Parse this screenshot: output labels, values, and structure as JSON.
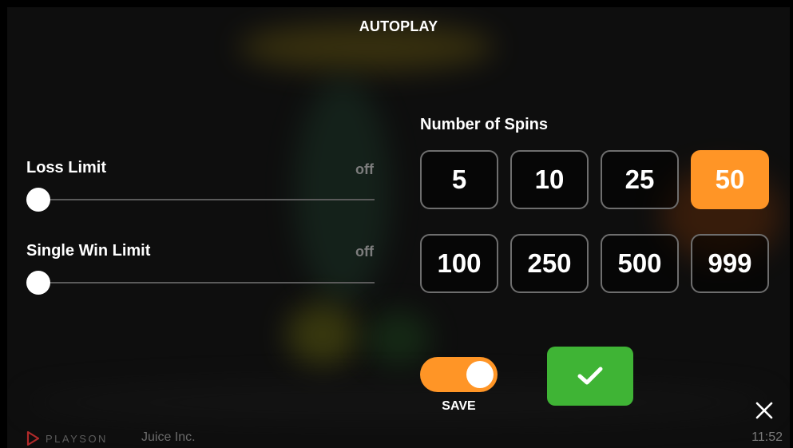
{
  "dialog": {
    "title": "AUTOPLAY"
  },
  "limits": [
    {
      "label": "Loss Limit",
      "value": "off",
      "slider_position": 0
    },
    {
      "label": "Single Win Limit",
      "value": "off",
      "slider_position": 0
    }
  ],
  "spins": {
    "title": "Number of Spins",
    "options": [
      "5",
      "10",
      "25",
      "50",
      "100",
      "250",
      "500",
      "999"
    ],
    "selected": "50"
  },
  "save": {
    "label": "SAVE",
    "enabled": true
  },
  "confirm": {
    "icon": "checkmark-icon"
  },
  "close": {
    "icon": "close-icon"
  },
  "footer": {
    "brand": "PLAYSON",
    "company": "Juice Inc.",
    "time": "11:52"
  },
  "colors": {
    "accent": "#ff9526",
    "confirm": "#3fb435",
    "muted": "#7d7d7d"
  }
}
